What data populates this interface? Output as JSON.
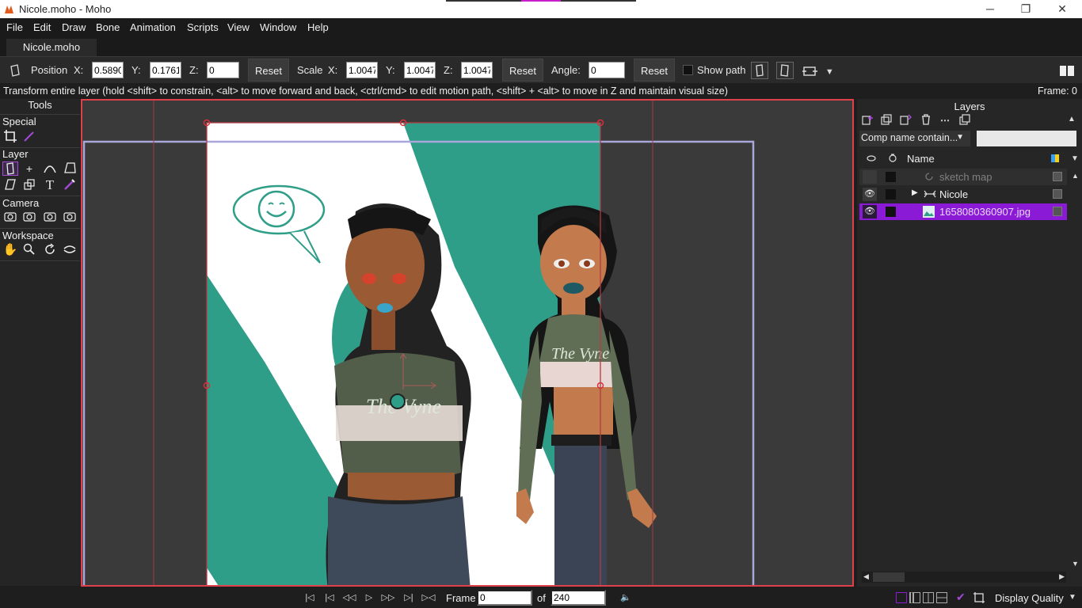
{
  "window": {
    "title": "Nicole.moho - Moho",
    "minimize": "─",
    "maximize": "❐",
    "close": "✕"
  },
  "menu": [
    "File",
    "Edit",
    "Draw",
    "Bone",
    "Animation",
    "Scripts",
    "View",
    "Window",
    "Help"
  ],
  "doc_tab": "Nicole.moho",
  "toolbar": {
    "position_label": "Position",
    "x_label": "X:",
    "pos_x": "0.5890",
    "y_label": "Y:",
    "pos_y": "0.1761",
    "z_label": "Z:",
    "pos_z": "0",
    "reset_label": "Reset",
    "scale_label": "Scale",
    "scale_x": "1.0047",
    "scale_y": "1.0047",
    "scale_z": "1.0047",
    "angle_label": "Angle:",
    "angle": "0",
    "show_path_label": "Show path"
  },
  "status": {
    "text": "Transform entire layer (hold <shift> to constrain, <alt> to move forward and back, <ctrl/cmd> to edit motion path, <shift> + <alt> to move in Z and maintain visual size)",
    "frame": "Frame: 0"
  },
  "tools": {
    "header": "Tools",
    "sections": {
      "special": "Special",
      "layer": "Layer",
      "camera": "Camera",
      "workspace": "Workspace"
    }
  },
  "layers_panel": {
    "title": "Layers",
    "comp_filter": "Comp name contain...",
    "name_header": "Name",
    "layers": [
      {
        "name": "sketch map",
        "visible": false,
        "selected": false
      },
      {
        "name": "Nicole",
        "visible": true,
        "selected": false
      },
      {
        "name": "1658080360907.jpg",
        "visible": true,
        "selected": true
      }
    ]
  },
  "playback": {
    "frame_label": "Frame",
    "frame_value": "0",
    "of_label": "of",
    "total_frames": "240",
    "display_quality": "Display Quality"
  },
  "speech_bubble": {
    "shirt_text": "The Vyne"
  },
  "colors": {
    "accent": "#8b1ad6",
    "selection_border": "#e0404a",
    "teal": "#2f9e88",
    "canvas_bg": "#3a3a3a"
  }
}
